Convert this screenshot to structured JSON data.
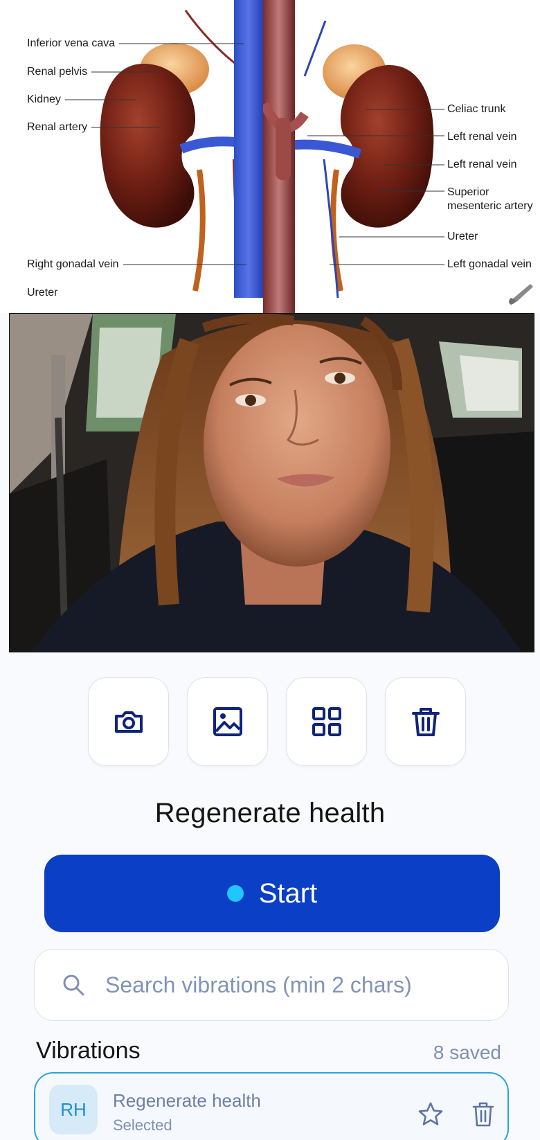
{
  "anatomy": {
    "labels_left": [
      "Inferior vena cava",
      "Renal pelvis",
      "Kidney",
      "Renal artery",
      "Right gonadal vein",
      "Ureter"
    ],
    "labels_right": [
      "Celiac trunk",
      "Left renal vein",
      "Left renal vein",
      "Superior mesenteric artery",
      "Ureter",
      "Left gonadal vein"
    ]
  },
  "toolbar": {
    "icons": [
      "camera-icon",
      "image-icon",
      "grid-icon",
      "trash-icon"
    ]
  },
  "title": "Regenerate health",
  "start": {
    "label": "Start",
    "dot_color": "#22c6ff",
    "button_color": "#0a3fc6"
  },
  "search": {
    "placeholder": "Search vibrations (min 2 chars)",
    "value": ""
  },
  "vibrations": {
    "heading": "Vibrations",
    "count_label": "8 saved",
    "items": [
      {
        "initials": "RH",
        "name": "Regenerate health",
        "status": "Selected"
      }
    ]
  },
  "colors": {
    "accent": "#0a3fc6",
    "selected_border": "#2ba4d8",
    "icon_navy": "#10237a"
  }
}
